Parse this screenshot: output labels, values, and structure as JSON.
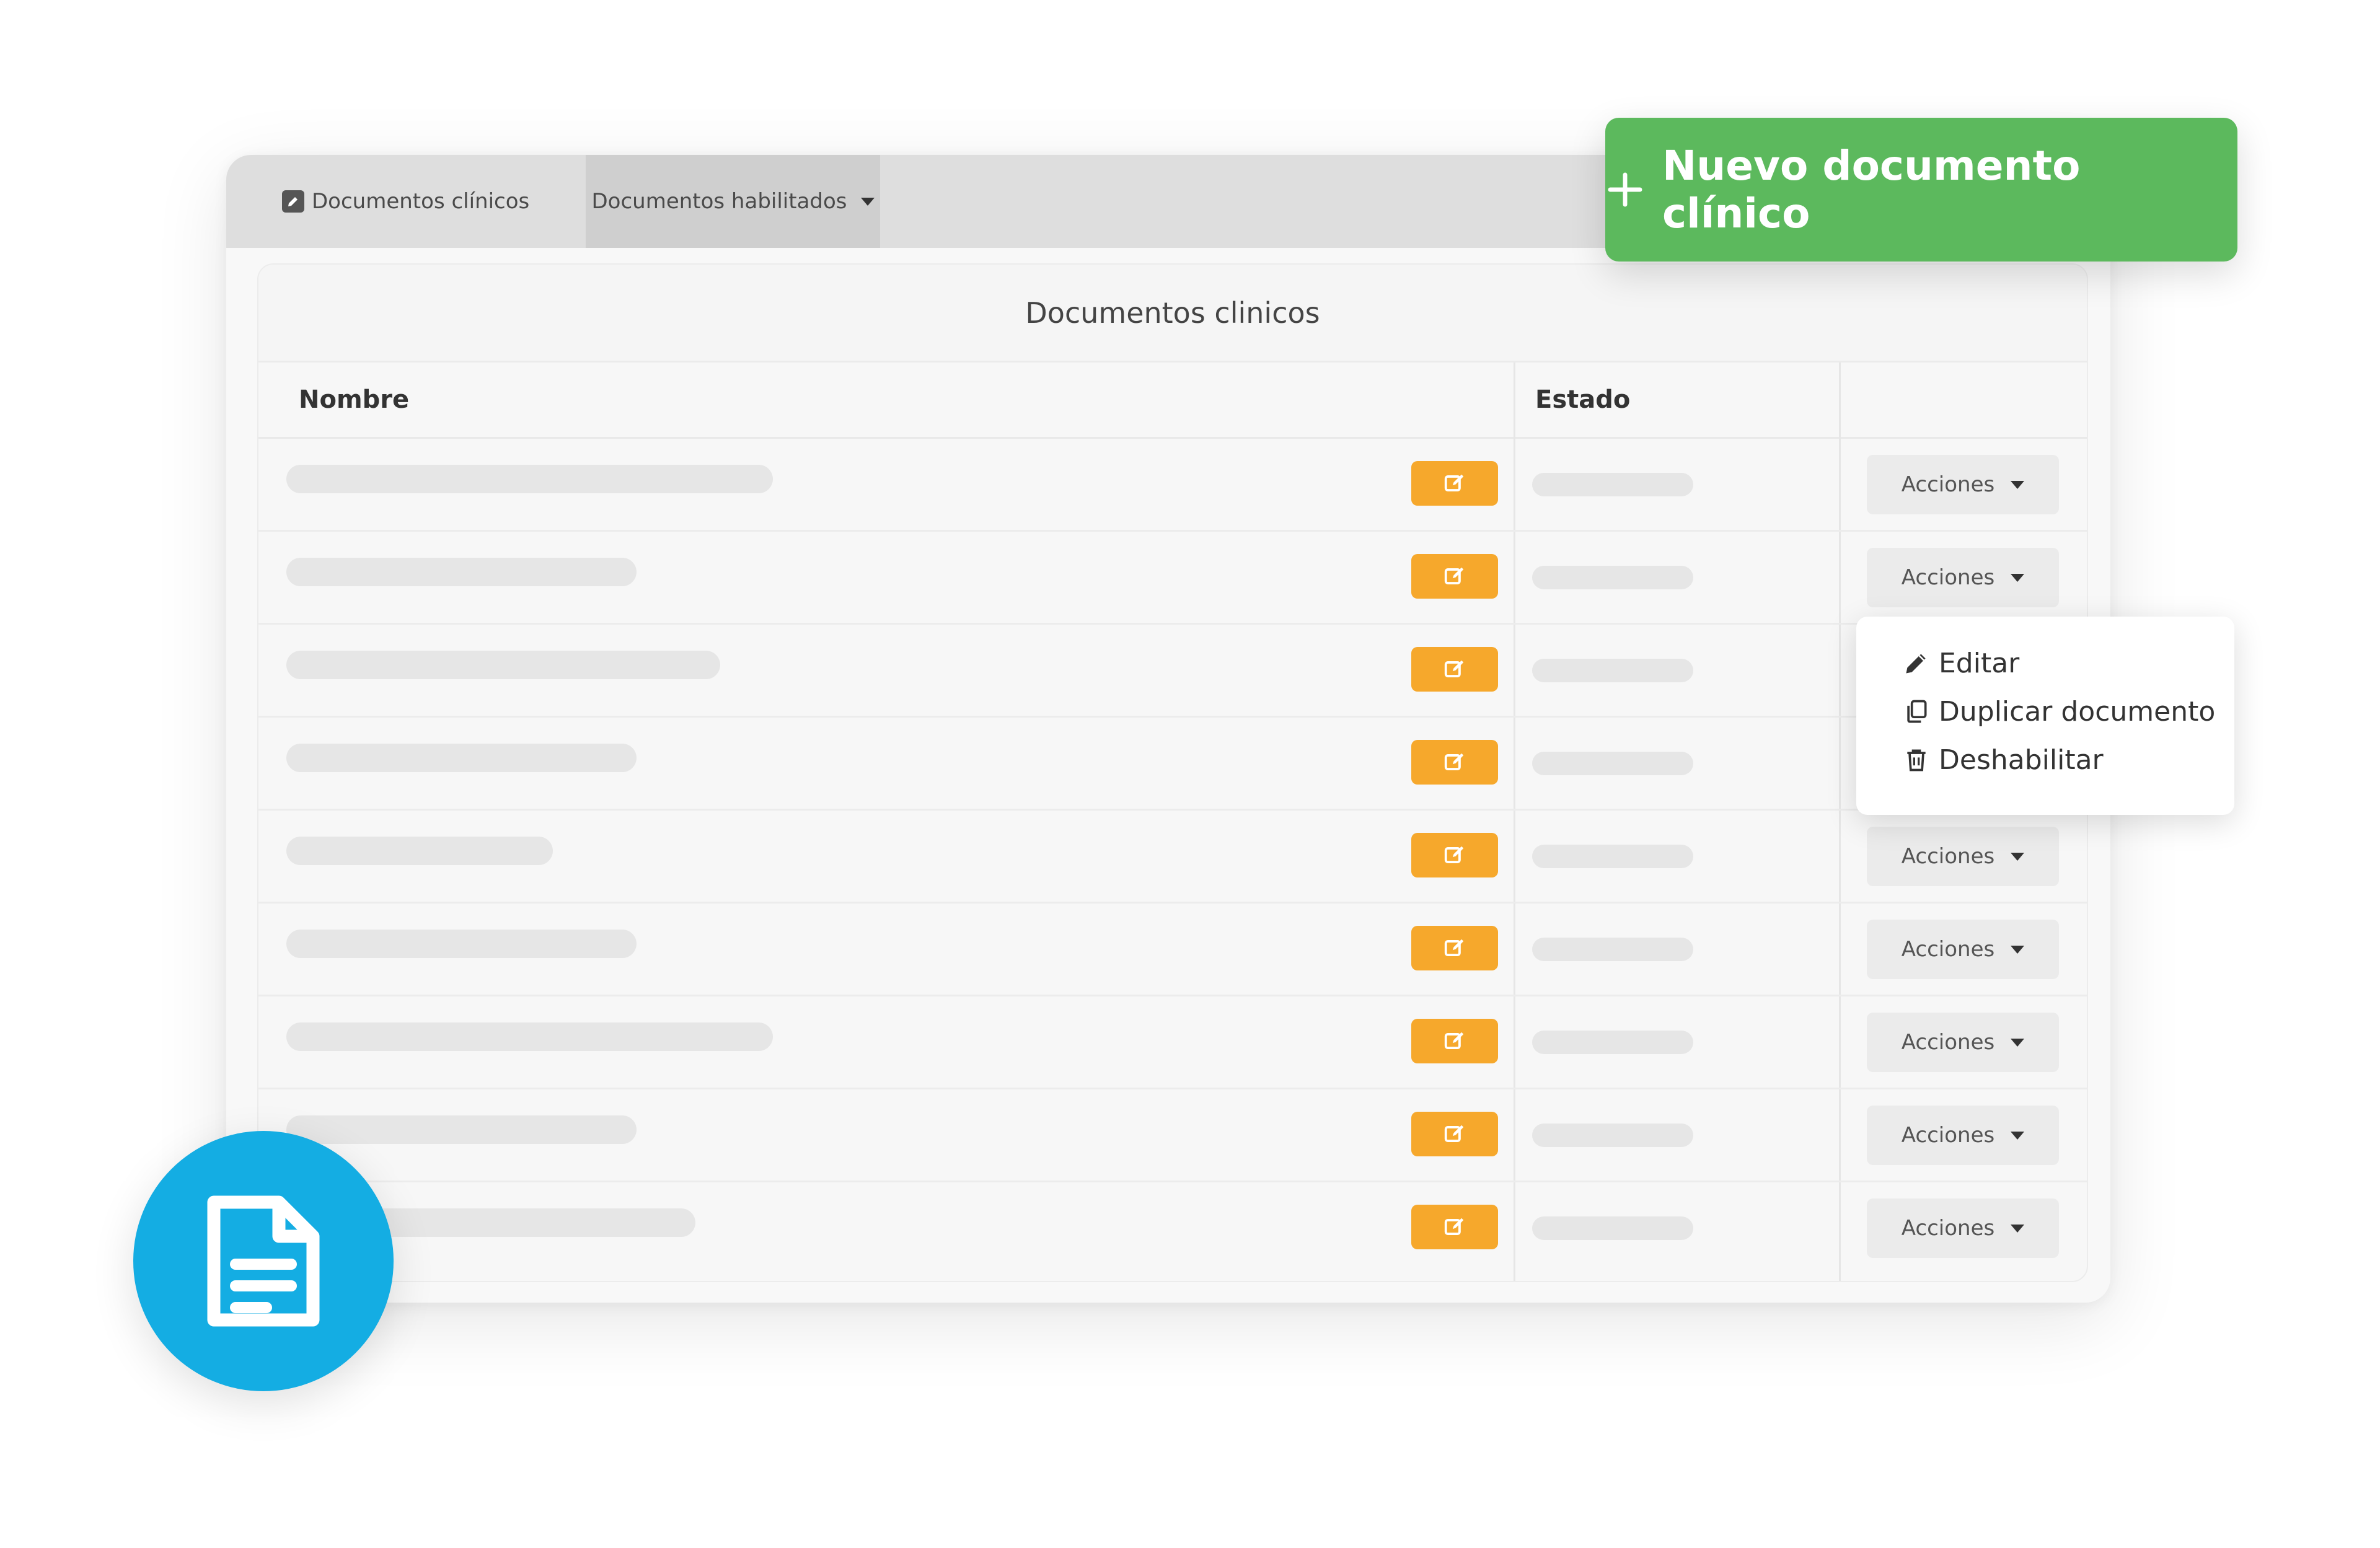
{
  "tabs": {
    "documentos": "Documentos clínicos",
    "habilitados": "Documentos habilitados"
  },
  "panel": {
    "title": "Documentos clinicos",
    "col_nombre": "Nombre",
    "col_estado": "Estado"
  },
  "rows": [
    {
      "acciones": "Acciones"
    },
    {
      "acciones": "Acciones"
    },
    {
      "acciones": ""
    },
    {
      "acciones": ""
    },
    {
      "acciones": "Acciones"
    },
    {
      "acciones": "Acciones"
    },
    {
      "acciones": "Acciones"
    },
    {
      "acciones": "Acciones"
    },
    {
      "acciones": "Acciones"
    }
  ],
  "new_button": {
    "label": "Nuevo documento clínico"
  },
  "dropdown": {
    "editar": "Editar",
    "duplicar": "Duplicar documento",
    "deshabilitar": "Deshabilitar"
  },
  "colors": {
    "green": "#5cb95d",
    "orange": "#f6a82c",
    "blue": "#14ade3"
  },
  "icons": [
    "edit-icon",
    "chevron-down-icon",
    "plus-icon",
    "pencil-icon",
    "copy-icon",
    "trash-icon",
    "document-icon"
  ]
}
